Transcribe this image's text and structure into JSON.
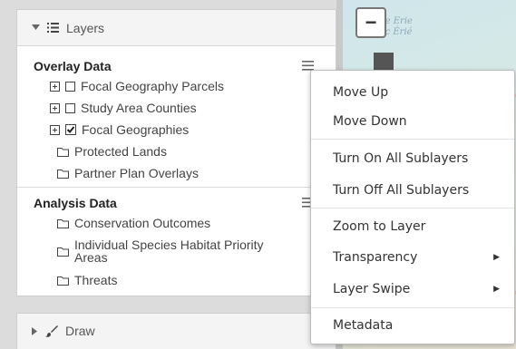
{
  "layers_panel": {
    "title": "Layers",
    "overlay": {
      "title": "Overlay Data",
      "items": [
        {
          "label": "Focal Geography Parcels",
          "expandable": true,
          "checked": false
        },
        {
          "label": "Study Area Counties",
          "expandable": true,
          "checked": false
        },
        {
          "label": "Focal Geographies",
          "expandable": true,
          "checked": true
        },
        {
          "label": "Protected Lands",
          "folder": true
        },
        {
          "label": "Partner Plan Overlays",
          "folder": true
        }
      ]
    },
    "analysis": {
      "title": "Analysis Data",
      "items": [
        {
          "label": "Conservation Outcomes"
        },
        {
          "label_line1": "Individual Species Habitat Priority",
          "label_line2": "Areas"
        },
        {
          "label": "Threats"
        }
      ]
    }
  },
  "draw_panel": {
    "title": "Draw"
  },
  "map": {
    "lake_label_1": "Lake Erie",
    "lake_label_2": "Lac Érié",
    "zoom_out": "−"
  },
  "context_menu": {
    "move_up": "Move Up",
    "move_down": "Move Down",
    "turn_on_all": "Turn On All Sublayers",
    "turn_off_all": "Turn Off All Sublayers",
    "zoom_to_layer": "Zoom to Layer",
    "transparency": "Transparency",
    "layer_swipe": "Layer Swipe",
    "metadata": "Metadata"
  }
}
